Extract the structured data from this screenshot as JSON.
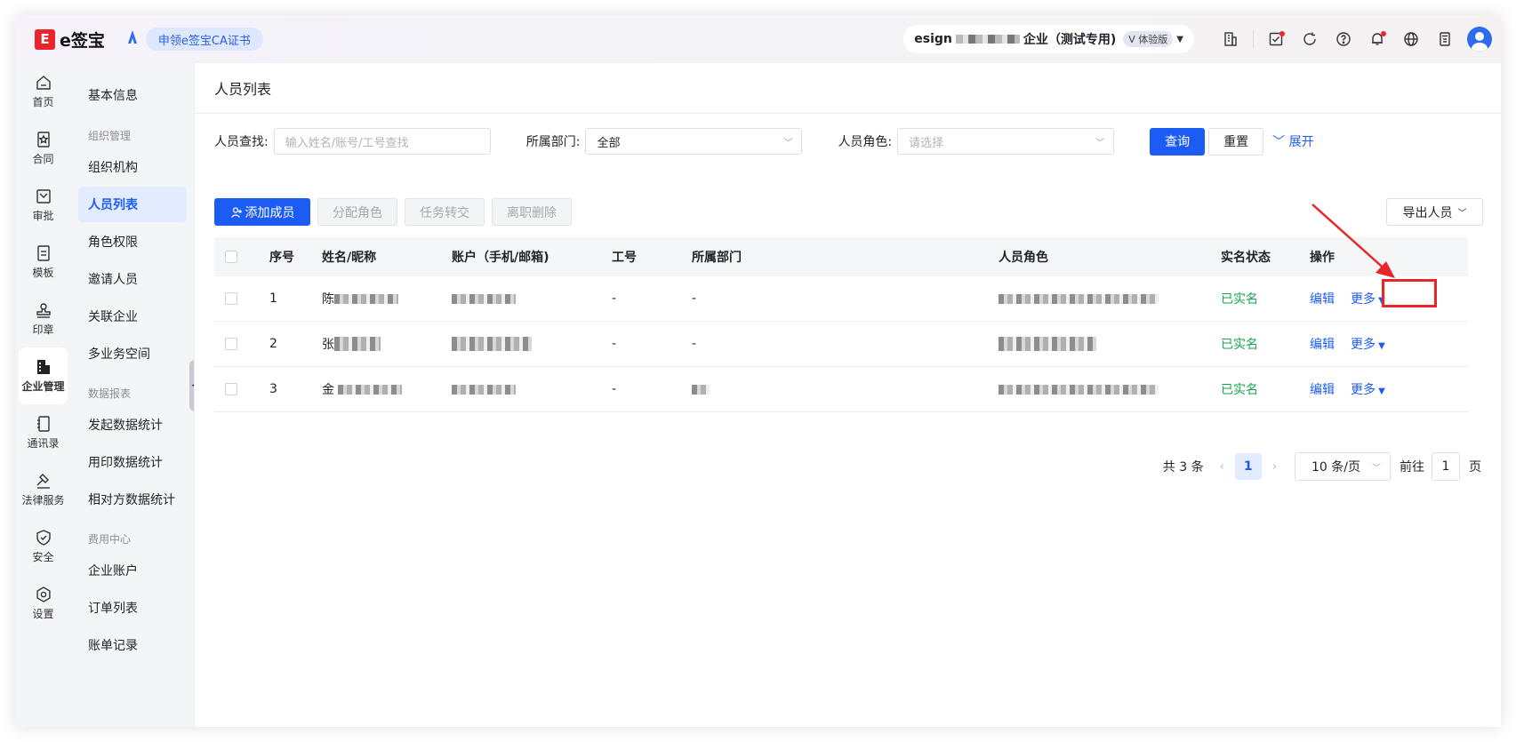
{
  "header": {
    "logo_mark": "E",
    "logo_text": "e签宝",
    "ca_button": "申领e签宝CA证书",
    "org_prefix": "esign",
    "org_suffix": "企业（测试专用)",
    "org_tag": "V 体验版",
    "icons": [
      "building-icon",
      "task-icon",
      "history-icon",
      "help-icon",
      "bell-icon",
      "globe-icon",
      "calculator-icon",
      "user-avatar"
    ]
  },
  "rail": [
    {
      "label": "首页",
      "icon": "home-icon"
    },
    {
      "label": "合同",
      "icon": "contract-icon"
    },
    {
      "label": "审批",
      "icon": "approval-icon"
    },
    {
      "label": "模板",
      "icon": "template-icon"
    },
    {
      "label": "印章",
      "icon": "seal-icon"
    },
    {
      "label": "企业管理",
      "icon": "enterprise-icon",
      "active": true
    },
    {
      "label": "通讯录",
      "icon": "contacts-icon"
    },
    {
      "label": "法律服务",
      "icon": "legal-icon"
    },
    {
      "label": "安全",
      "icon": "shield-icon"
    },
    {
      "label": "设置",
      "icon": "gear-icon"
    }
  ],
  "subnav": {
    "basic_info": "基本信息",
    "group_org": "组织管理",
    "org_items": [
      "组织机构",
      "人员列表",
      "角色权限",
      "邀请人员",
      "关联企业",
      "多业务空间"
    ],
    "group_data": "数据报表",
    "data_items": [
      "发起数据统计",
      "用印数据统计",
      "相对方数据统计"
    ],
    "group_fee": "费用中心",
    "fee_items": [
      "企业账户",
      "订单列表",
      "账单记录"
    ]
  },
  "main": {
    "title": "人员列表",
    "filters": {
      "search_label": "人员查找:",
      "search_placeholder": "输入姓名/账号/工号查找",
      "dept_label": "所属部门:",
      "dept_value": "全部",
      "role_label": "人员角色:",
      "role_placeholder": "请选择",
      "query_btn": "查询",
      "reset_btn": "重置",
      "expand_link": "展开"
    },
    "actions": {
      "add_member": "添加成员",
      "assign_role": "分配角色",
      "transfer_task": "任务转交",
      "resign_delete": "离职删除",
      "export": "导出人员"
    },
    "table": {
      "columns": [
        "序号",
        "姓名/昵称",
        "账户（手机/邮箱)",
        "工号",
        "所属部门",
        "人员角色",
        "实名状态",
        "操作"
      ],
      "rows": [
        {
          "no": "1",
          "name_initial": "陈",
          "gh": "-",
          "dept": "-",
          "status": "已实名",
          "edit": "编辑",
          "more": "更多"
        },
        {
          "no": "2",
          "name_initial": "张",
          "gh": "-",
          "dept": "-",
          "status": "已实名",
          "edit": "编辑",
          "more": "更多"
        },
        {
          "no": "3",
          "name_initial": "金",
          "gh": "-",
          "dept": "",
          "status": "已实名",
          "edit": "编辑",
          "more": "更多"
        }
      ]
    },
    "pagination": {
      "total": "共 3 条",
      "current": "1",
      "page_size": "10 条/页",
      "goto_label": "前往",
      "goto_value": "1",
      "page_unit": "页"
    }
  },
  "colors": {
    "primary": "#1c5cf5",
    "success": "#14a44d",
    "highlight": "#e8262a"
  }
}
